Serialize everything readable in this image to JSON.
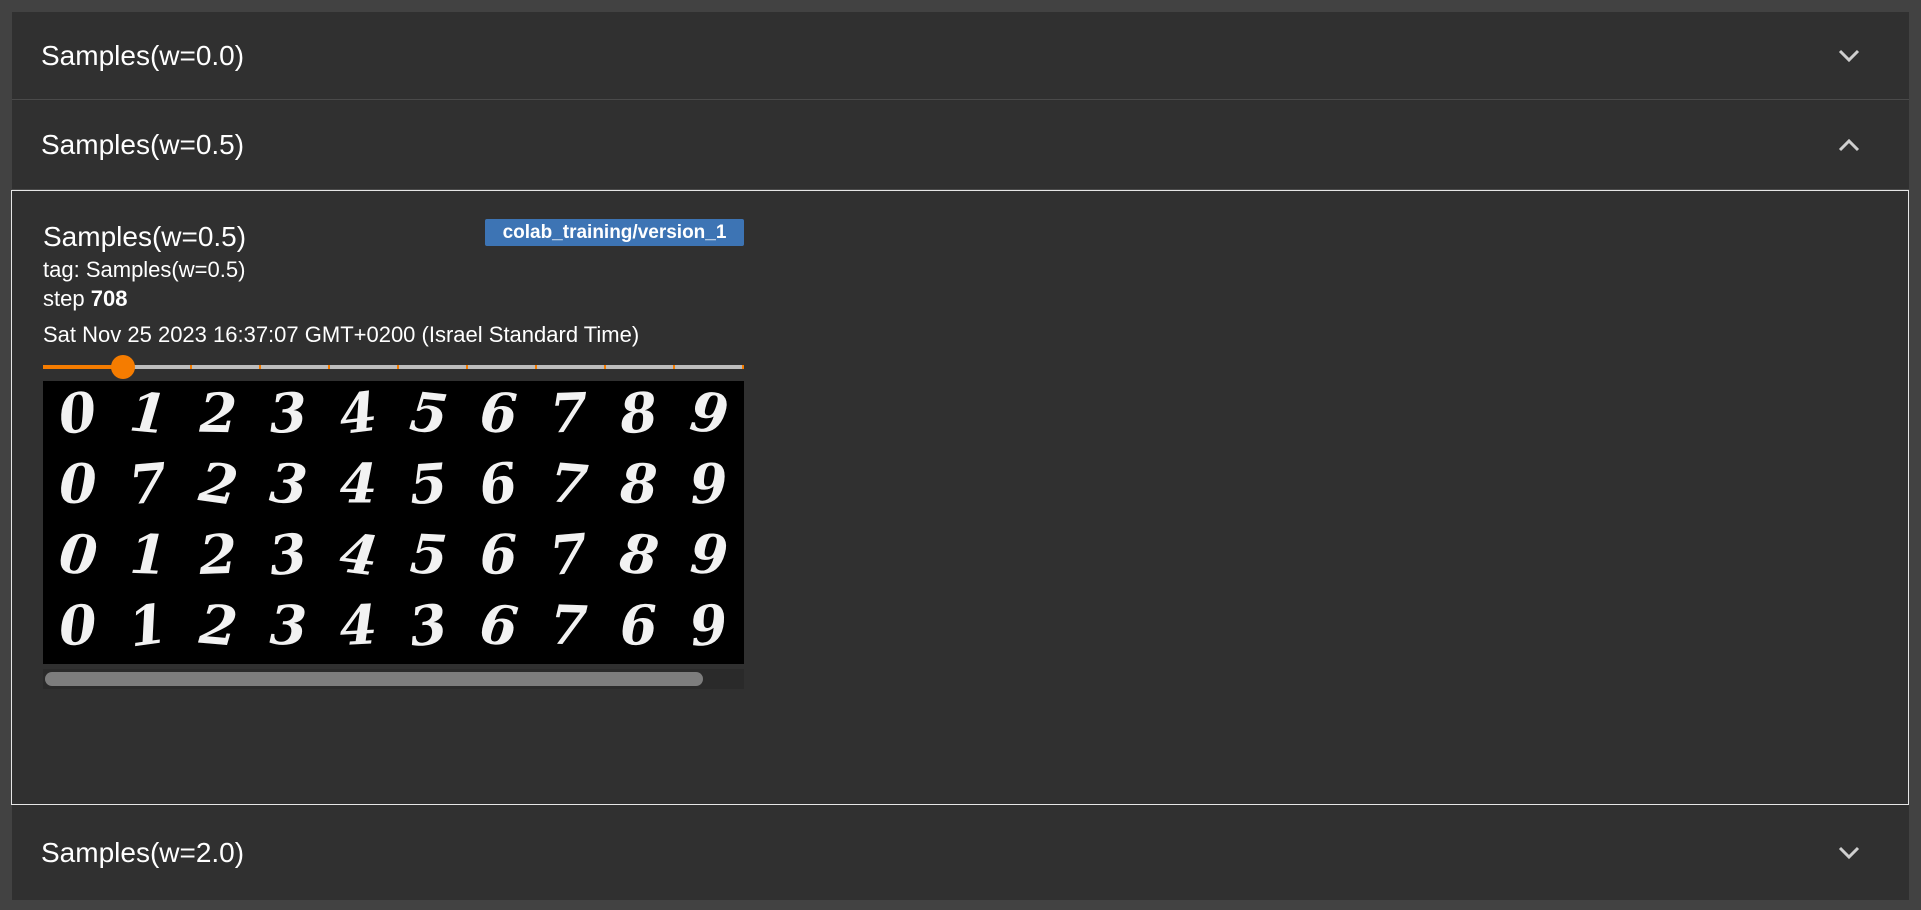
{
  "sections": [
    {
      "title": "Samples(w=0.0)",
      "expanded": false,
      "chevron_icon": "chevron-down-icon"
    },
    {
      "title": "Samples(w=0.5)",
      "expanded": true,
      "chevron_icon": "chevron-up-icon"
    },
    {
      "title": "Samples(w=2.0)",
      "expanded": false,
      "chevron_icon": "chevron-down-icon"
    }
  ],
  "card": {
    "title": "Samples(w=0.5)",
    "run": "colab_training/version_1",
    "tag_label": "tag:",
    "tag_value": "Samples(w=0.5)",
    "step_label": "step",
    "step_value": "708",
    "timestamp": "Sat Nov 25 2023 16:37:07 GMT+0200 (Israel Standard Time)",
    "slider": {
      "position_fraction": 0.114,
      "tick_count": 10
    },
    "image": {
      "description_icon": "mnist-digit-grid-image",
      "rows": [
        [
          "0",
          "1",
          "2",
          "3",
          "4",
          "5",
          "6",
          "7",
          "8",
          "9"
        ],
        [
          "0",
          "7",
          "2",
          "3",
          "4",
          "5",
          "6",
          "7",
          "8",
          "9"
        ],
        [
          "0",
          "1",
          "2",
          "3",
          "4",
          "5",
          "6",
          "7",
          "8",
          "9"
        ],
        [
          "0",
          "1",
          "2",
          "3",
          "4",
          "3",
          "6",
          "7",
          "6",
          "9"
        ]
      ]
    }
  },
  "colors": {
    "background": "#2f2f2f",
    "accent": "#f57c00",
    "run_badge": "#3d74b4",
    "panel_border": "#e6e6e6"
  }
}
